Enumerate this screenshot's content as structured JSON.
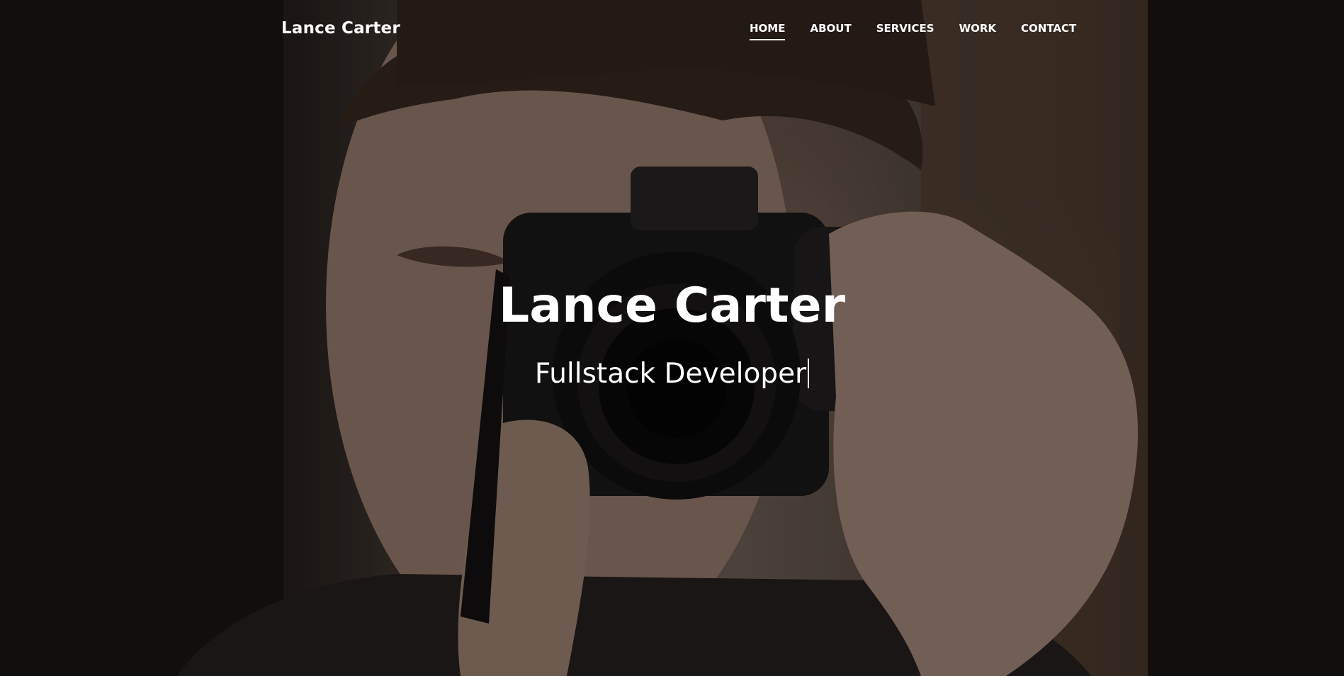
{
  "brand": {
    "name": "Lance Carter"
  },
  "nav": {
    "items": [
      {
        "label": "HOME",
        "active": true
      },
      {
        "label": "ABOUT",
        "active": false
      },
      {
        "label": "SERVICES",
        "active": false
      },
      {
        "label": "WORK",
        "active": false
      },
      {
        "label": "CONTACT",
        "active": false
      }
    ]
  },
  "hero": {
    "title": "Lance Carter",
    "subtitle": "Fullstack Developer",
    "background_image": "photographer-holding-canon-camera"
  },
  "colors": {
    "text": "#ffffff",
    "overlay": "rgba(0,0,0,0.38)"
  }
}
